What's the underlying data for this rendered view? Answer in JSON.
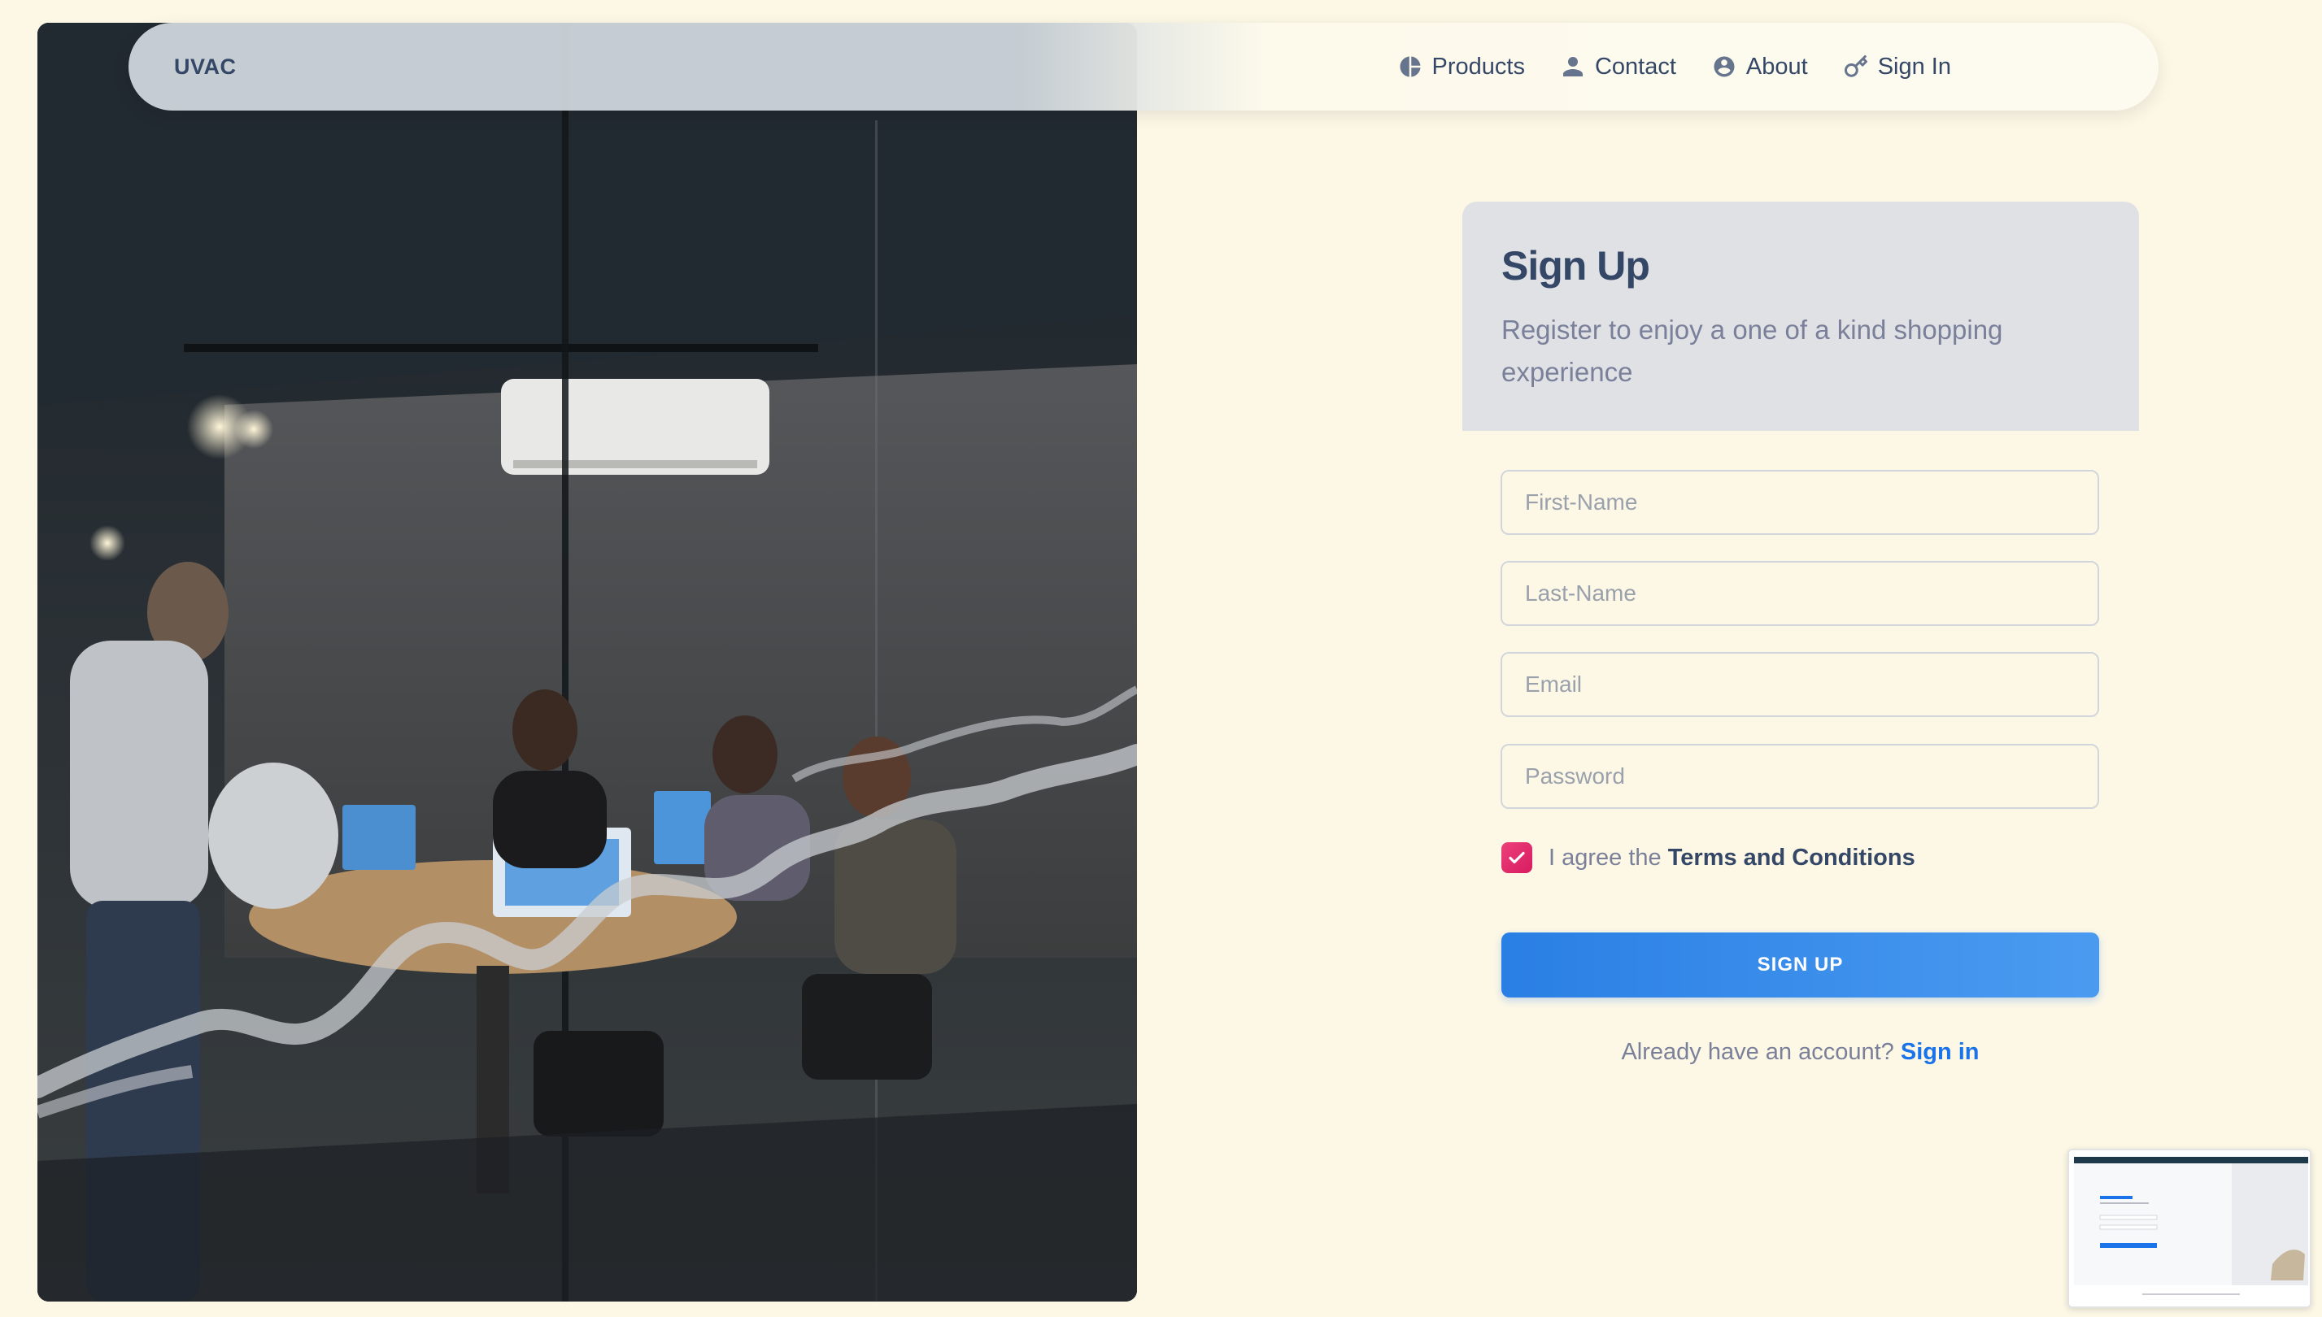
{
  "navbar": {
    "brand": "UVAC",
    "links": [
      {
        "label": "Products",
        "icon": "pie-chart-icon"
      },
      {
        "label": "Contact",
        "icon": "person-icon"
      },
      {
        "label": "About",
        "icon": "account-circle-icon"
      },
      {
        "label": "Sign In",
        "icon": "key-icon"
      }
    ]
  },
  "hero": {
    "image": "photo of people working at laptops in a glass-walled meeting room at night"
  },
  "signup": {
    "title": "Sign Up",
    "subtitle": "Register to enjoy a one of a kind shopping experience",
    "fields": {
      "first_name": {
        "placeholder": "First-Name",
        "value": ""
      },
      "last_name": {
        "placeholder": "Last-Name",
        "value": ""
      },
      "email": {
        "placeholder": "Email",
        "value": ""
      },
      "password": {
        "placeholder": "Password",
        "value": ""
      }
    },
    "terms": {
      "prefix": "I agree the ",
      "link": "Terms and Conditions",
      "checked": true
    },
    "button": "SIGN UP",
    "already": {
      "text": "Already have an account?",
      "link": "Sign in"
    }
  },
  "colors": {
    "background": "#fdf8e6",
    "primary": "#1a73e8",
    "checkbox": "#e91e63",
    "heading": "#344767",
    "muted": "#7b809a"
  }
}
